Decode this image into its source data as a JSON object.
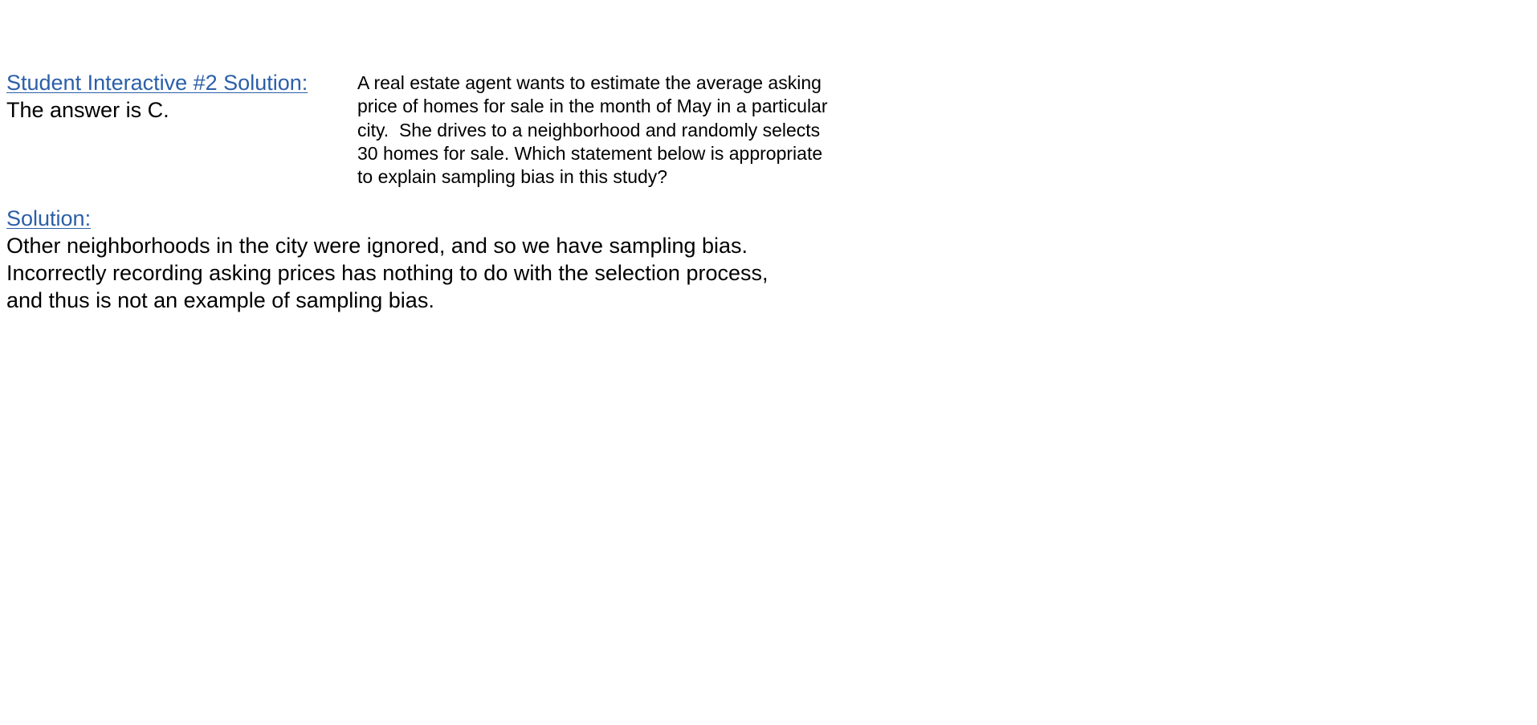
{
  "student_interactive": {
    "heading": "Student Interactive #2 Solution:",
    "answer": "The answer is C."
  },
  "question": {
    "lines": [
      "A real estate agent wants to estimate the average asking",
      "price of homes for sale in the month of May in a particular",
      "city.  She drives to a neighborhood and randomly selects",
      "30 homes for sale. Which statement below is appropriate",
      "to explain sampling bias in this study?"
    ]
  },
  "solution": {
    "heading": "Solution:",
    "lines": [
      "Other neighborhoods in the city were ignored, and so we have sampling bias.",
      "Incorrectly recording asking prices has nothing to do with the selection process,",
      "and thus is not an example of sampling bias."
    ]
  },
  "colors": {
    "link": "#2b5fa8",
    "text": "#000000",
    "background": "#ffffff"
  }
}
